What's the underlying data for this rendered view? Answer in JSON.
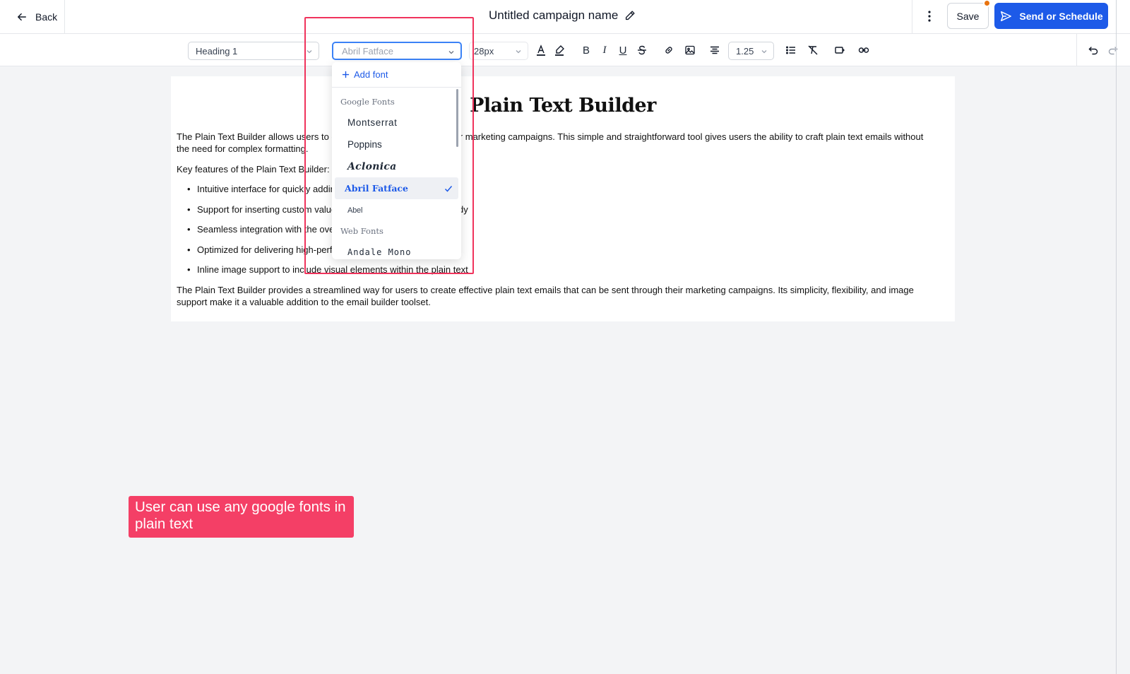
{
  "header": {
    "back_label": "Back",
    "campaign_name": "Untitled campaign name",
    "save_label": "Save",
    "send_label": "Send or Schedule"
  },
  "toolbar": {
    "block_type": "Heading 1",
    "font_placeholder": "Abril Fatface",
    "font_size": "28px",
    "line_height": "1.25",
    "bold_glyph": "B",
    "italic_glyph": "I",
    "underline_glyph": "U"
  },
  "font_dropdown": {
    "add_font_label": "Add font",
    "google_fonts_label": "Google Fonts",
    "google_fonts": [
      "Montserrat",
      "Poppins",
      "Aclonica",
      "Abril Fatface",
      "Abel"
    ],
    "selected_font": "Abril Fatface",
    "web_fonts_label": "Web Fonts",
    "web_fonts": [
      "Andale Mono"
    ]
  },
  "document": {
    "title": "Plain Text Builder",
    "paragraph_1": "The Plain Text Builder allows users to create plain text content for their marketing campaigns. This simple and straightforward tool gives users the ability to craft plain text emails without the need for complex formatting.",
    "paragraph_2": "Key features of the Plain Text Builder:",
    "bullets": [
      "Intuitive interface for quickly adding and editing text",
      "Support for inserting custom values and links within the email body",
      "Seamless integration with the overall campaign builder",
      "Optimized for delivering high-performing plain text campaigns",
      "Inline image support to include visual elements within the plain text"
    ],
    "paragraph_3": "The Plain Text Builder provides a streamlined way for users to create effective plain text emails that can be sent through their marketing campaigns. Its simplicity, flexibility, and image support make it a valuable addition to the email builder toolset."
  },
  "annotation": {
    "callout_text": "User can use any google fonts in plain text",
    "highlight_color": "#f0335c",
    "callout_color": "#f43f66"
  },
  "colors": {
    "primary": "#1d5ae8",
    "notification_dot": "#e8730f"
  }
}
